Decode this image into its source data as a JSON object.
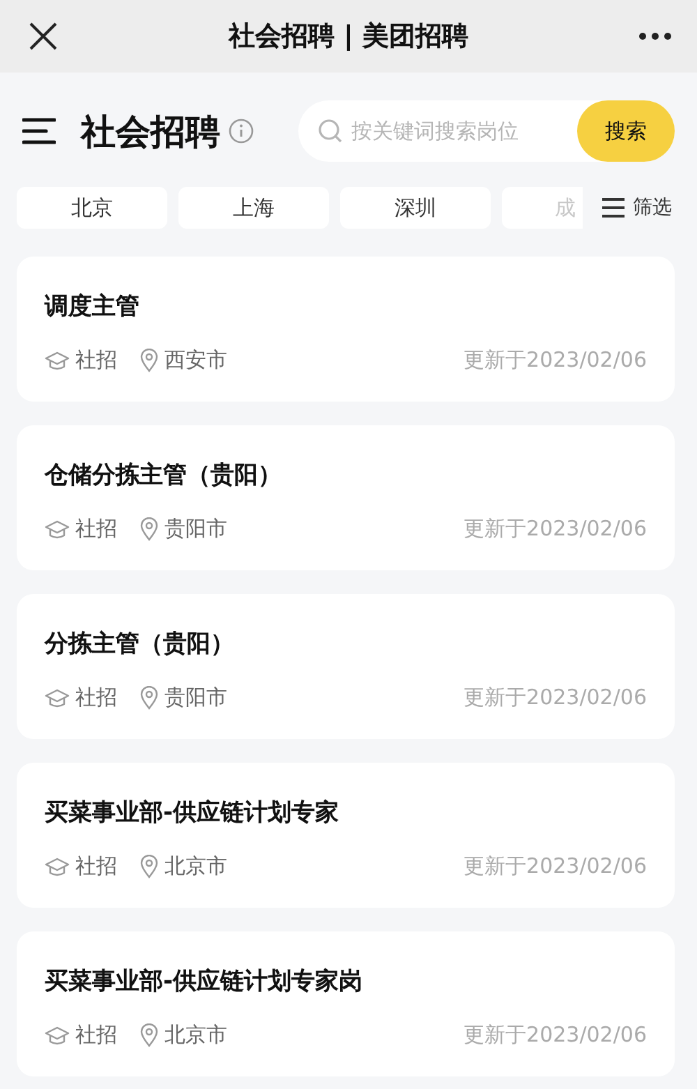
{
  "top_bar": {
    "title": "社会招聘 | 美团招聘"
  },
  "header": {
    "title": "社会招聘",
    "search": {
      "placeholder": "按关键词搜索岗位",
      "button": "搜索"
    }
  },
  "cities": [
    {
      "label": "北京",
      "faded": false
    },
    {
      "label": "上海",
      "faded": false
    },
    {
      "label": "深圳",
      "faded": false
    },
    {
      "label": "成",
      "faded": true
    }
  ],
  "filter": {
    "label": "筛选"
  },
  "jobs": [
    {
      "title": "调度主管",
      "type": "社招",
      "city": "西安市",
      "updated": "更新于2023/02/06"
    },
    {
      "title": "仓储分拣主管（贵阳）",
      "type": "社招",
      "city": "贵阳市",
      "updated": "更新于2023/02/06"
    },
    {
      "title": "分拣主管（贵阳）",
      "type": "社招",
      "city": "贵阳市",
      "updated": "更新于2023/02/06"
    },
    {
      "title": "买菜事业部-供应链计划专家",
      "type": "社招",
      "city": "北京市",
      "updated": "更新于2023/02/06"
    },
    {
      "title": "买菜事业部-供应链计划专家岗",
      "type": "社招",
      "city": "北京市",
      "updated": "更新于2023/02/06"
    }
  ]
}
